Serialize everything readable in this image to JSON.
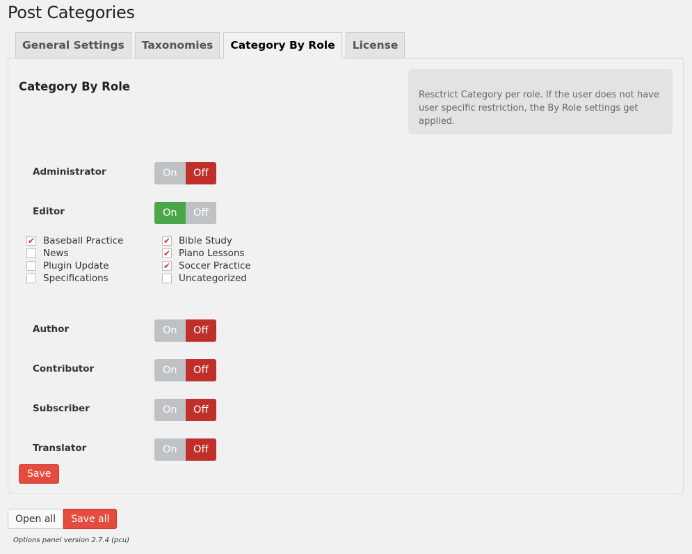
{
  "page": {
    "title": "Post Categories"
  },
  "tabs": [
    {
      "label": "General Settings",
      "active": false
    },
    {
      "label": "Taxonomies",
      "active": false
    },
    {
      "label": "Category By Role",
      "active": true
    },
    {
      "label": "License",
      "active": false
    }
  ],
  "section": {
    "title": "Category By Role",
    "info": "Resctrict Category per role. If the user does not have user specific restriction, the By Role settings get applied."
  },
  "toggle_labels": {
    "on": "On",
    "off": "Off"
  },
  "roles": [
    {
      "label": "Administrator",
      "state": "off"
    },
    {
      "label": "Editor",
      "state": "on"
    },
    {
      "label": "Author",
      "state": "off"
    },
    {
      "label": "Contributor",
      "state": "off"
    },
    {
      "label": "Subscriber",
      "state": "off"
    },
    {
      "label": "Translator",
      "state": "off"
    }
  ],
  "editor_categories": {
    "left": [
      {
        "label": "Baseball Practice",
        "checked": true
      },
      {
        "label": "News",
        "checked": false
      },
      {
        "label": "Plugin Update",
        "checked": false
      },
      {
        "label": "Specifications",
        "checked": false
      }
    ],
    "right": [
      {
        "label": "Bible Study",
        "checked": true
      },
      {
        "label": "Piano Lessons",
        "checked": true
      },
      {
        "label": "Soccer Practice",
        "checked": true
      },
      {
        "label": "Uncategorized",
        "checked": false
      }
    ]
  },
  "buttons": {
    "save": "Save",
    "open_all": "Open all",
    "save_all": "Save all"
  },
  "footer": {
    "version": "Options panel version 2.7.4 (pcu)"
  },
  "colors": {
    "off_active": "#c0302a",
    "on_active": "#4aa74a",
    "inactive": "#bec2c5",
    "button_red": "#e54b3f"
  }
}
